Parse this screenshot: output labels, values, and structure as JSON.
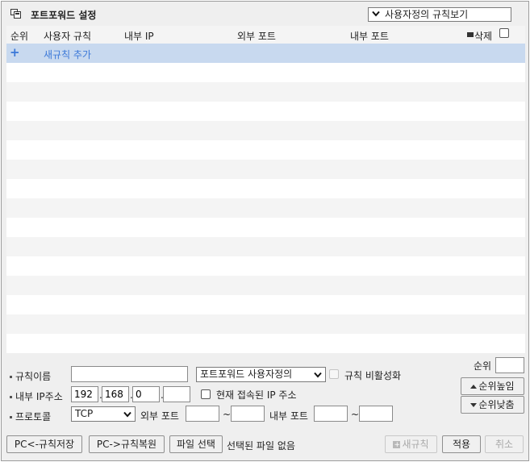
{
  "header": {
    "title": "포트포워드 설정",
    "view_select": "사용자정의 규칙보기"
  },
  "table": {
    "columns": [
      "순위",
      "사용자 규칙",
      "내부 IP",
      "외부 포트",
      "내부 포트",
      "삭제"
    ],
    "add_rule_label": "새규칙 추가"
  },
  "form": {
    "rule_name_label": "규칙이름",
    "rule_name_value": "",
    "rule_type_select": "포트포워드 사용자정의",
    "disable_rule_label": "규칙 비활성화",
    "internal_ip_label": "내부 IP주소",
    "ip": [
      "192",
      "168",
      "0",
      ""
    ],
    "current_ip_label": "현재 접속된 IP 주소",
    "protocol_label": "프로토콜",
    "protocol_value": "TCP",
    "external_port_label": "외부 포트",
    "internal_port_label": "내부 포트",
    "range_sep": "~",
    "priority_label": "순위",
    "priority_up": "순위높임",
    "priority_down": "순위낮춤"
  },
  "bottom": {
    "save_to_pc": "PC<-규칙저장",
    "restore_from_pc": "PC->규칙복원",
    "choose_file": "파일 선택",
    "no_file": "선택된 파일 없음",
    "new_rule": "새규칙",
    "apply": "적용",
    "cancel": "취소"
  }
}
